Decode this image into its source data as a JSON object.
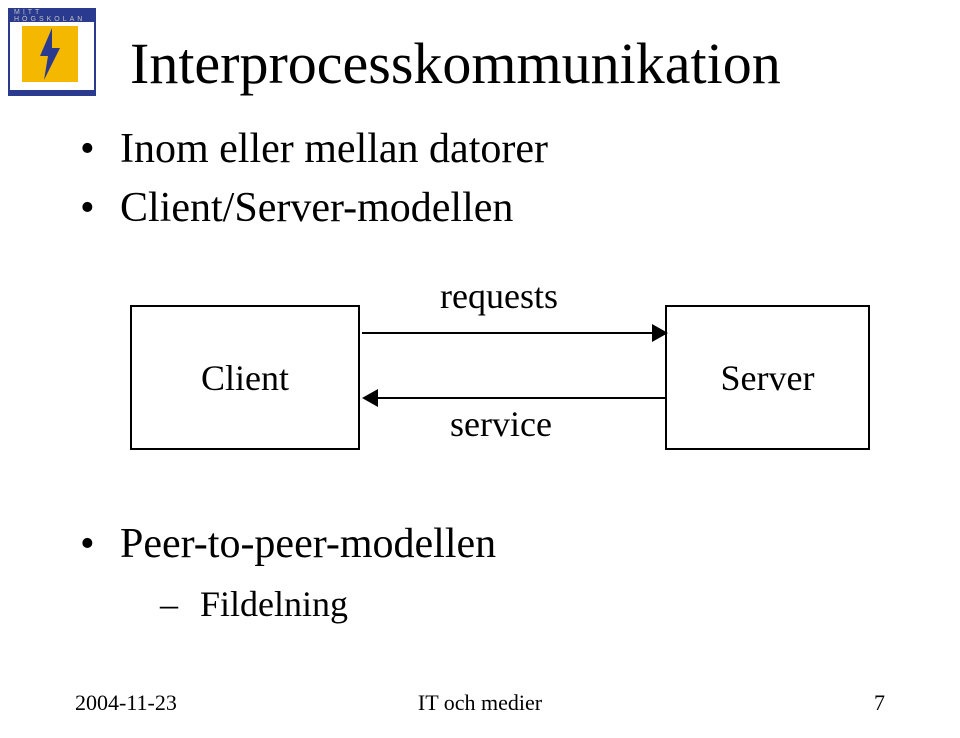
{
  "logo": {
    "text": "MITT HÖGSKOLAN"
  },
  "title": "Interprocesskommunikation",
  "bullets": [
    "Inom eller mellan datorer",
    "Client/Server-modellen"
  ],
  "diagram": {
    "client_label": "Client",
    "server_label": "Server",
    "top_arrow_label": "requests",
    "bottom_arrow_label": "service"
  },
  "bullets2": {
    "main": "Peer-to-peer-modellen",
    "sub": "Fildelning"
  },
  "footer": {
    "date": "2004-11-23",
    "center": "IT och medier",
    "page": "7"
  }
}
